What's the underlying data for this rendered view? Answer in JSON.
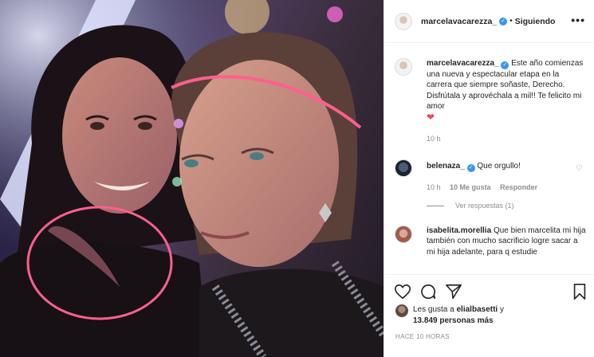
{
  "post": {
    "username": "marcelavacarezza_",
    "following_label": "Siguiendo",
    "more_label": "•••"
  },
  "caption": {
    "username": "marcelavacarezza_",
    "text": "Este año comienzas una nueva y espectacular etapa en la carrera que siempre soñaste, Derecho. Disfrútala y aprovéchala a mil!! Te felicito mi amor",
    "emoji": "❤",
    "time": "10 h"
  },
  "comments": [
    {
      "username": "belenaza_",
      "text": "Que orgullo!",
      "time": "10 h",
      "likes": "10 Me gusta",
      "reply_label": "Responder",
      "view_replies": "Ver respuestas (1)"
    },
    {
      "username": "isabelita.morellia",
      "text": "Que bien marcelita mi hija también con mucho sacrificio logre sacar a mi hija adelante, para q estudie"
    }
  ],
  "likes": {
    "prefix": "Les gusta a",
    "user": "elialbasetti",
    "conj": "y",
    "count": "13.849 personas más"
  },
  "timestamp": "HACE 10 HORAS",
  "colors": {
    "verified": "#3897f0",
    "heart": "#ed4956",
    "meta": "#8e8e8e"
  }
}
